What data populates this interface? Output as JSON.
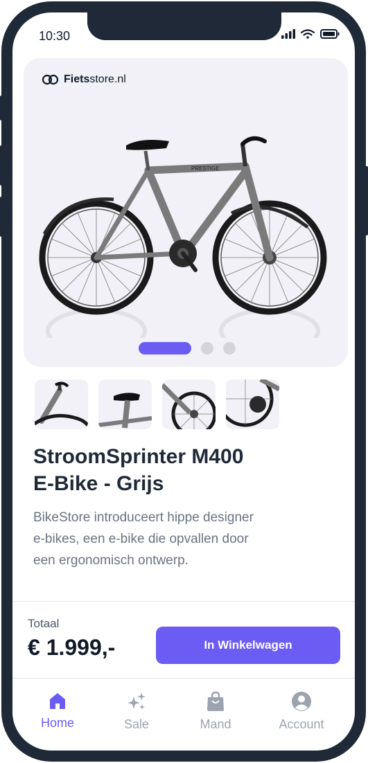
{
  "status_bar": {
    "time": "10:30"
  },
  "hero": {
    "brand_bold": "Fiets",
    "brand_rest": "store.nl",
    "bike_text": "PRESTIGE",
    "carousel": {
      "slides": 3,
      "active_index": 0
    }
  },
  "thumbnails": [
    "handlebar",
    "saddle",
    "front-wheel",
    "rear-wheel"
  ],
  "product": {
    "title_line1": "StroomSprinter M400",
    "title_line2": "E-Bike - Grijs",
    "description_line1": "BikeStore introduceert hippe designer",
    "description_line2": "e-bikes, een e-bike die opvallen door",
    "description_line3": "een ergonomisch ontwerp."
  },
  "checkout": {
    "total_label": "Totaal",
    "price": "€ 1.999,-",
    "cart_button": "In Winkelwagen"
  },
  "nav": {
    "items": [
      {
        "label": "Home",
        "icon": "home-icon",
        "active": true
      },
      {
        "label": "Sale",
        "icon": "sparkles-icon",
        "active": false
      },
      {
        "label": "Mand",
        "icon": "shopping-bag-icon",
        "active": false
      },
      {
        "label": "Account",
        "icon": "user-circle-icon",
        "active": false
      }
    ]
  },
  "colors": {
    "accent": "#6b5cf3",
    "frame": "#1f2937",
    "card_background": "#f1f1f7",
    "muted_text": "#9ca3af"
  }
}
